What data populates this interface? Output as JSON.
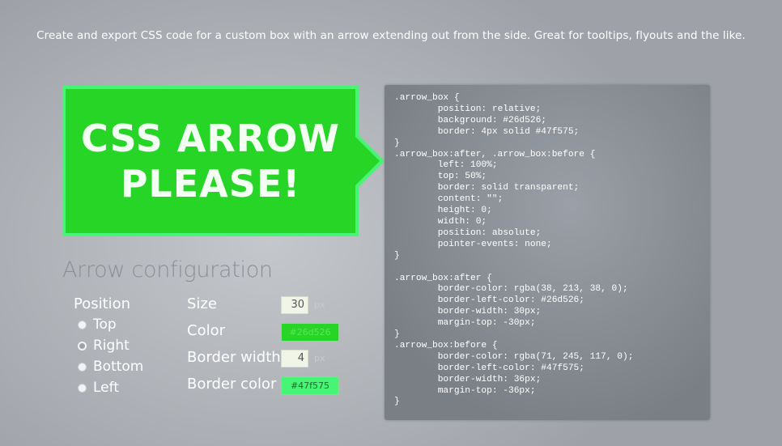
{
  "tagline": "Create and export CSS code for a custom box with an arrow extending out from the side. Great for tooltips, flyouts and the like.",
  "preview": {
    "line1": "CSS ARROW",
    "line2": "PLEASE!"
  },
  "config": {
    "title": "Arrow configuration",
    "position": {
      "label": "Position",
      "options": [
        {
          "label": "Top",
          "checked": false
        },
        {
          "label": "Right",
          "checked": true
        },
        {
          "label": "Bottom",
          "checked": false
        },
        {
          "label": "Left",
          "checked": false
        }
      ]
    },
    "size": {
      "label": "Size",
      "value": "30",
      "unit": "px"
    },
    "color": {
      "label": "Color",
      "value": "#26d526"
    },
    "border_width": {
      "label": "Border width",
      "value": "4",
      "unit": "px"
    },
    "border_color": {
      "label": "Border color",
      "value": "#47f575"
    }
  },
  "code": ".arrow_box {\n\tposition: relative;\n\tbackground: #26d526;\n\tborder: 4px solid #47f575;\n}\n.arrow_box:after, .arrow_box:before {\n\tleft: 100%;\n\ttop: 50%;\n\tborder: solid transparent;\n\tcontent: \"\";\n\theight: 0;\n\twidth: 0;\n\tposition: absolute;\n\tpointer-events: none;\n}\n\n.arrow_box:after {\n\tborder-color: rgba(38, 213, 38, 0);\n\tborder-left-color: #26d526;\n\tborder-width: 30px;\n\tmargin-top: -30px;\n}\n.arrow_box:before {\n\tborder-color: rgba(71, 245, 117, 0);\n\tborder-left-color: #47f575;\n\tborder-width: 36px;\n\tmargin-top: -36px;\n}"
}
